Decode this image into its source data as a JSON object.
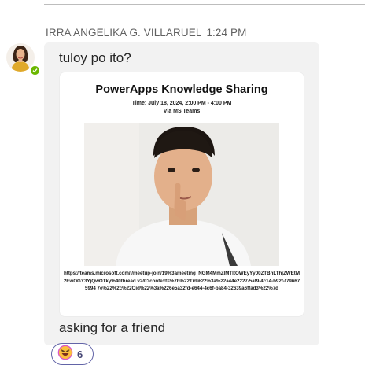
{
  "message": {
    "sender": "IRRA ANGELIKA G. VILLARUEL",
    "time": "1:24 PM",
    "text_top": "tuloy po ito?",
    "text_bottom": "asking for a friend",
    "avatar_status": "available"
  },
  "attachment": {
    "title": "PowerApps Knowledge Sharing",
    "time_line": "Time: July 18, 2024, 2:00 PM - 4:00 PM",
    "via_line": "Via MS Teams",
    "link": "https://teams.microsoft.com/l/meetup-join/19%3ameeting_NGM4MmZlMTltOWEyYy00ZTBhLThjZWEtM2EwOGY3YjQwOTky%40thread.v2/0?context=%7b%22Tid%22%3a%22a44e2227-5af9-4c14-b92f-f796675994 7e%22%2c%22Oid%22%3a%226e5a32fd-e644-4c6f-ba84-32639a6ffad3%22%7d"
  },
  "reaction": {
    "emoji": "laughing-face",
    "count": "6"
  },
  "colors": {
    "bubble": "#f2f2f2",
    "reaction_border": "#6264a7",
    "presence": "#6bb700"
  }
}
